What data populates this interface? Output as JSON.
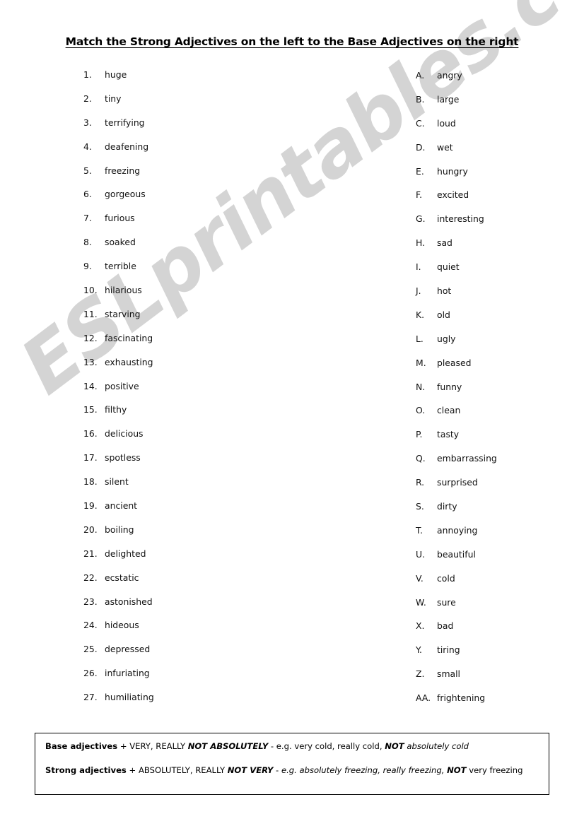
{
  "page": {
    "title": "Match the Strong Adjectives on the left to the Base Adjectives on the right",
    "watermark": "ESLprintables.com",
    "watermark_color": "#c9c9c9"
  },
  "left_column": {
    "heading_implicit": "Strong Adjectives",
    "items": [
      {
        "marker": "1.",
        "word": "huge"
      },
      {
        "marker": "2.",
        "word": "tiny"
      },
      {
        "marker": "3.",
        "word": "terrifying"
      },
      {
        "marker": "4.",
        "word": "deafening"
      },
      {
        "marker": "5.",
        "word": "freezing"
      },
      {
        "marker": "6.",
        "word": "gorgeous"
      },
      {
        "marker": "7.",
        "word": "furious"
      },
      {
        "marker": "8.",
        "word": "soaked"
      },
      {
        "marker": "9.",
        "word": "terrible"
      },
      {
        "marker": "10.",
        "word": "hilarious"
      },
      {
        "marker": "11.",
        "word": "starving"
      },
      {
        "marker": "12.",
        "word": "fascinating"
      },
      {
        "marker": "13.",
        "word": "exhausting"
      },
      {
        "marker": "14.",
        "word": "positive"
      },
      {
        "marker": "15.",
        "word": "filthy"
      },
      {
        "marker": "16.",
        "word": "delicious"
      },
      {
        "marker": "17.",
        "word": "spotless"
      },
      {
        "marker": "18.",
        "word": "silent"
      },
      {
        "marker": "19.",
        "word": "ancient"
      },
      {
        "marker": "20.",
        "word": "boiling"
      },
      {
        "marker": "21.",
        "word": "delighted"
      },
      {
        "marker": "22.",
        "word": "ecstatic"
      },
      {
        "marker": "23.",
        "word": "astonished"
      },
      {
        "marker": "24.",
        "word": "hideous"
      },
      {
        "marker": "25.",
        "word": "depressed"
      },
      {
        "marker": "26.",
        "word": "infuriating"
      },
      {
        "marker": "27.",
        "word": "humiliating"
      }
    ]
  },
  "right_column": {
    "heading_implicit": "Base Adjectives",
    "items": [
      {
        "marker": "A.",
        "word": "angry"
      },
      {
        "marker": "B.",
        "word": "large"
      },
      {
        "marker": "C.",
        "word": "loud"
      },
      {
        "marker": "D.",
        "word": "wet"
      },
      {
        "marker": "E.",
        "word": "hungry"
      },
      {
        "marker": "F.",
        "word": "excited"
      },
      {
        "marker": "G.",
        "word": "interesting"
      },
      {
        "marker": "H.",
        "word": "sad"
      },
      {
        "marker": "I.",
        "word": "quiet"
      },
      {
        "marker": "J.",
        "word": "hot"
      },
      {
        "marker": "K.",
        "word": "old"
      },
      {
        "marker": "L.",
        "word": "ugly"
      },
      {
        "marker": "M.",
        "word": "pleased"
      },
      {
        "marker": "N.",
        "word": "funny"
      },
      {
        "marker": "O.",
        "word": "clean"
      },
      {
        "marker": "P.",
        "word": "tasty"
      },
      {
        "marker": "Q.",
        "word": "embarrassing"
      },
      {
        "marker": "R.",
        "word": "surprised"
      },
      {
        "marker": "S.",
        "word": "dirty"
      },
      {
        "marker": "T.",
        "word": "annoying"
      },
      {
        "marker": "U.",
        "word": "beautiful"
      },
      {
        "marker": "V.",
        "word": "cold"
      },
      {
        "marker": "W.",
        "word": "sure"
      },
      {
        "marker": "X.",
        "word": "bad"
      },
      {
        "marker": "Y.",
        "word": "tiring"
      },
      {
        "marker": "Z.",
        "word": "small"
      },
      {
        "marker": "AA.",
        "word": "frightening"
      }
    ]
  },
  "rules_box": {
    "line1": {
      "label": "Base adjectives",
      "plus": " + ",
      "modifiers": "VERY, REALLY ",
      "negation": "NOT ABSOLUTELY",
      "dash": " - ",
      "example_prefix": "e.g. very cold, really cold, ",
      "example_not": "NOT",
      "example_suffix": " absolutely cold"
    },
    "line2": {
      "label": "Strong adjectives",
      "plus": " + ",
      "modifiers": "ABSOLUTELY, REALLY ",
      "negation": "NOT VERY",
      "dash": " - ",
      "example_prefix": "e.g. absolutely freezing, really freezing, ",
      "example_not": "NOT",
      "example_suffix": " very freezing"
    }
  }
}
